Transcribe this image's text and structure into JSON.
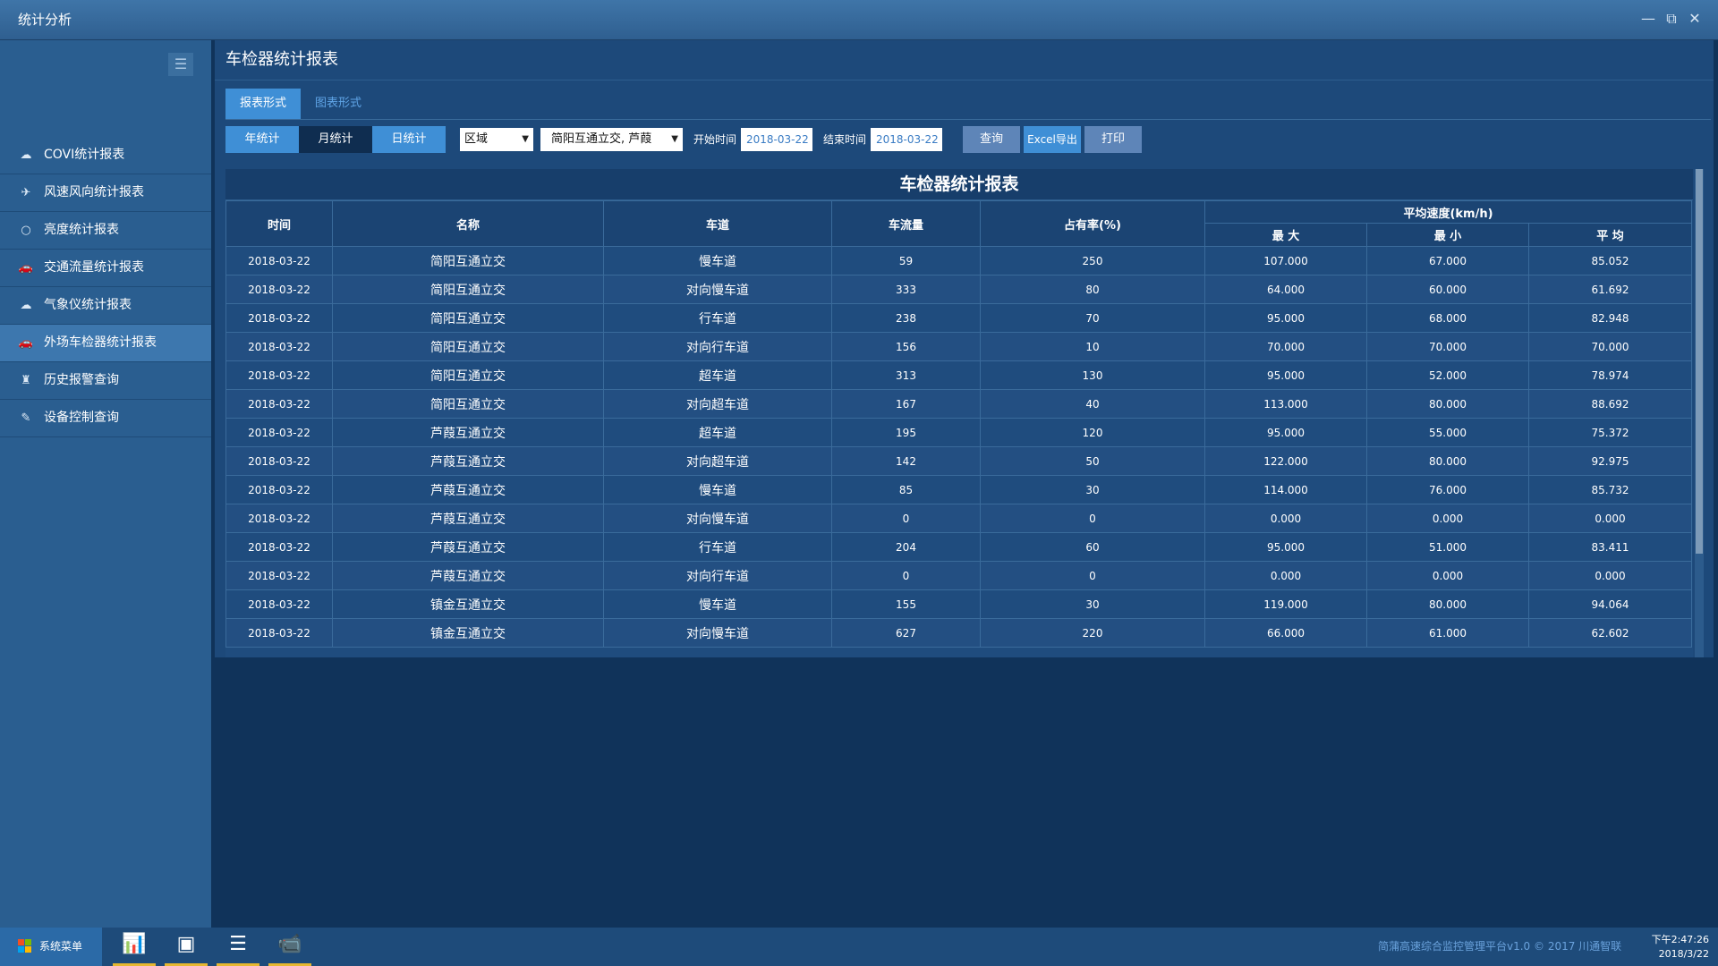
{
  "window": {
    "title": "统计分析",
    "controls": [
      "—",
      "⧉",
      "✕"
    ]
  },
  "sidebar": {
    "toggle_icon": "☰",
    "items": [
      {
        "label": "COVI统计报表",
        "icon": "☁",
        "icon_name": "cloud-icon"
      },
      {
        "label": "风速风向统计报表",
        "icon": "✈",
        "icon_name": "plane-icon"
      },
      {
        "label": "亮度统计报表",
        "icon": "○",
        "icon_name": "circle-icon"
      },
      {
        "label": "交通流量统计报表",
        "icon": "🚗",
        "icon_name": "car-icon"
      },
      {
        "label": "气象仪统计报表",
        "icon": "☁",
        "icon_name": "cloud-icon"
      },
      {
        "label": "外场车检器统计报表",
        "icon": "🚗",
        "icon_name": "car-icon",
        "active": true
      },
      {
        "label": "历史报警查询",
        "icon": "♜",
        "icon_name": "alarm-icon"
      },
      {
        "label": "设备控制查询",
        "icon": "✎",
        "icon_name": "wrench-icon"
      }
    ]
  },
  "main": {
    "title": "车检器统计报表",
    "tabs": [
      {
        "label": "报表形式",
        "active": true
      },
      {
        "label": "图表形式",
        "active": false
      }
    ],
    "toolbar": {
      "year": "年统计",
      "month": "月统计",
      "day": "日统计",
      "region_select": "区域",
      "station_select": "简阳互通立交, 芦葭",
      "start_label": "开始时间",
      "start_value": "2018-03-22",
      "end_label": "结束时间",
      "end_value": "2018-03-22",
      "query": "查询",
      "excel": "Excel导出",
      "print": "打印"
    },
    "report": {
      "title": "车检器统计报表",
      "headers": {
        "time": "时间",
        "name": "名称",
        "lane": "车道",
        "flow": "车流量",
        "occupancy": "占有率(%)",
        "avg_speed": "平均速度(km/h)",
        "max": "最 大",
        "min": "最 小",
        "avg": "平 均"
      },
      "rows": [
        [
          "2018-03-22",
          "简阳互通立交",
          "慢车道",
          "59",
          "250",
          "107.000",
          "67.000",
          "85.052"
        ],
        [
          "2018-03-22",
          "简阳互通立交",
          "对向慢车道",
          "333",
          "80",
          "64.000",
          "60.000",
          "61.692"
        ],
        [
          "2018-03-22",
          "简阳互通立交",
          "行车道",
          "238",
          "70",
          "95.000",
          "68.000",
          "82.948"
        ],
        [
          "2018-03-22",
          "简阳互通立交",
          "对向行车道",
          "156",
          "10",
          "70.000",
          "70.000",
          "70.000"
        ],
        [
          "2018-03-22",
          "简阳互通立交",
          "超车道",
          "313",
          "130",
          "95.000",
          "52.000",
          "78.974"
        ],
        [
          "2018-03-22",
          "简阳互通立交",
          "对向超车道",
          "167",
          "40",
          "113.000",
          "80.000",
          "88.692"
        ],
        [
          "2018-03-22",
          "芦葭互通立交",
          "超车道",
          "195",
          "120",
          "95.000",
          "55.000",
          "75.372"
        ],
        [
          "2018-03-22",
          "芦葭互通立交",
          "对向超车道",
          "142",
          "50",
          "122.000",
          "80.000",
          "92.975"
        ],
        [
          "2018-03-22",
          "芦葭互通立交",
          "慢车道",
          "85",
          "30",
          "114.000",
          "76.000",
          "85.732"
        ],
        [
          "2018-03-22",
          "芦葭互通立交",
          "对向慢车道",
          "0",
          "0",
          "0.000",
          "0.000",
          "0.000"
        ],
        [
          "2018-03-22",
          "芦葭互通立交",
          "行车道",
          "204",
          "60",
          "95.000",
          "51.000",
          "83.411"
        ],
        [
          "2018-03-22",
          "芦葭互通立交",
          "对向行车道",
          "0",
          "0",
          "0.000",
          "0.000",
          "0.000"
        ],
        [
          "2018-03-22",
          "镇金互通立交",
          "慢车道",
          "155",
          "30",
          "119.000",
          "80.000",
          "94.064"
        ],
        [
          "2018-03-22",
          "镇金互通立交",
          "对向慢车道",
          "627",
          "220",
          "66.000",
          "61.000",
          "62.602"
        ]
      ]
    }
  },
  "taskbar": {
    "start_label": "系统菜单",
    "apps": [
      {
        "icon": "📊",
        "name": "chart-app-icon"
      },
      {
        "icon": "▣",
        "name": "camera-grid-app-icon"
      },
      {
        "icon": "☰",
        "name": "list-app-icon"
      },
      {
        "icon": "📹",
        "name": "video-app-icon"
      }
    ],
    "copyright": "简蒲高速综合监控管理平台v1.0 © 2017 川通智联",
    "time": "下午2:47:26",
    "date": "2018/3/22"
  },
  "colors": {
    "accent": "#3f8fd6",
    "background": "#10335a",
    "panel": "#1d497a",
    "sidebar": "#2a5e90",
    "taskbar_underline": "#e5b730"
  }
}
